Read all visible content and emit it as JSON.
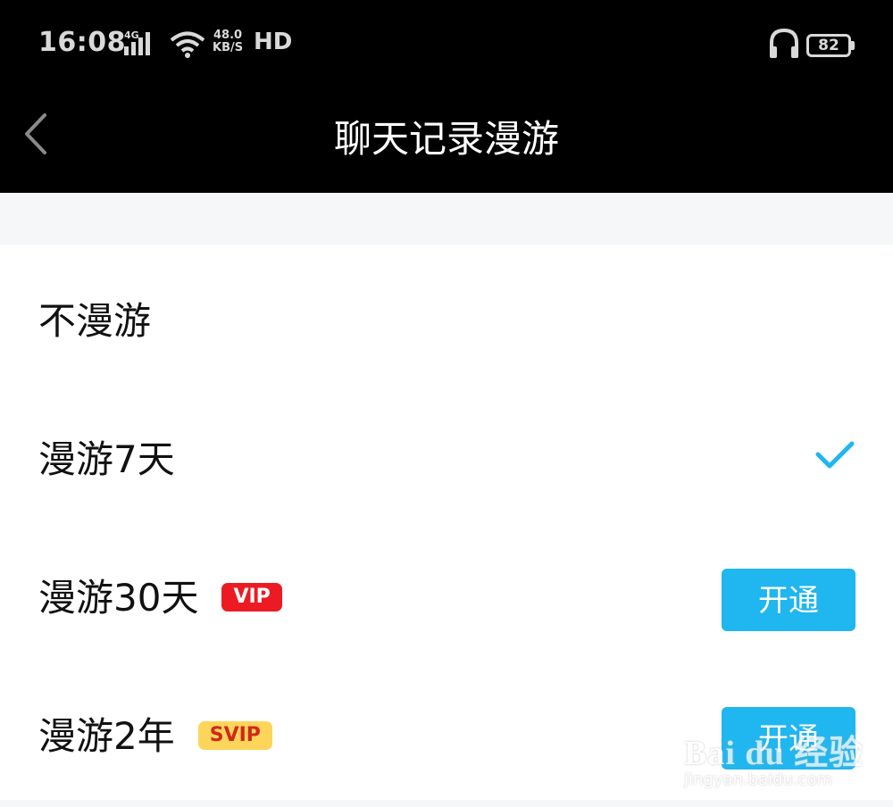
{
  "status_bar": {
    "time": "16:08",
    "network": "4G",
    "speed_value": "48.0",
    "speed_unit": "KB/S",
    "hd": "HD",
    "battery": "82"
  },
  "header": {
    "title": "聊天记录漫游"
  },
  "options": [
    {
      "label": "不漫游",
      "selected": false
    },
    {
      "label": "漫游7天",
      "selected": true
    },
    {
      "label": "漫游30天",
      "badge": "VIP",
      "button": "开通"
    },
    {
      "label": "漫游2年",
      "badge": "SVIP",
      "button": "开通"
    }
  ],
  "watermark": {
    "main": "Bai du 经验",
    "sub": "jingyan.baidu.com"
  },
  "colors": {
    "accent": "#20b6ef",
    "vip": "#ec1b23",
    "svip": "#fdd55a"
  }
}
